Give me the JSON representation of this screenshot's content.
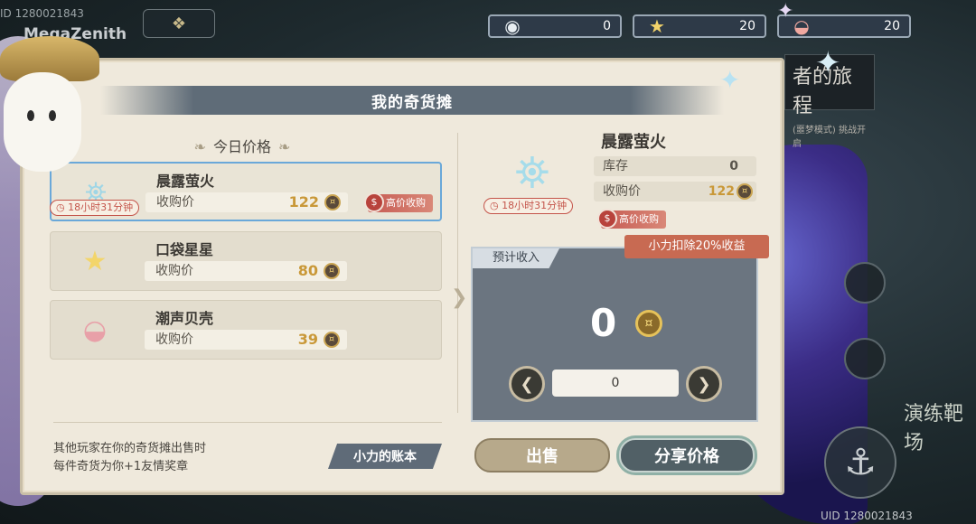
{
  "player": {
    "uid_top": "ID 1280021843",
    "name": "MegaZenith",
    "uid_bottom": "UID 1280021843"
  },
  "currencies": [
    {
      "icon": "eye-orb-icon",
      "value": "0"
    },
    {
      "icon": "star-icon",
      "value": "20"
    },
    {
      "icon": "shell-icon",
      "value": "20"
    }
  ],
  "background": {
    "sign_title": "者的旅程",
    "sign_sub": "(噩梦模式) 挑战开启",
    "right_label": "演练靶场"
  },
  "panel": {
    "title": "我的奇货摊",
    "section_title": "今日价格",
    "items": [
      {
        "name": "晨露萤火",
        "price_label": "收购价",
        "price": "122",
        "timer": "18小时31分钟",
        "high_tag": "高价收购",
        "icon": "lantern-icon"
      },
      {
        "name": "口袋星星",
        "price_label": "收购价",
        "price": "80",
        "icon": "star-icon"
      },
      {
        "name": "潮声贝壳",
        "price_label": "收购价",
        "price": "39",
        "icon": "shell-icon"
      }
    ],
    "info_line1": "其他玩家在你的奇货摊出售时",
    "info_line2": "每件奇货为你+1友情奖章",
    "ledger_button": "小力的账本"
  },
  "detail": {
    "name": "晨露萤火",
    "stock_label": "库存",
    "stock": "0",
    "price_label": "收购价",
    "price": "122",
    "timer": "18小时31分钟",
    "high_tag": "高价收购",
    "income_label": "预计收入",
    "deduct_tag": "小力扣除20%收益",
    "income_value": "0",
    "quantity": "0",
    "sell_button": "出售",
    "share_button": "分享价格"
  }
}
